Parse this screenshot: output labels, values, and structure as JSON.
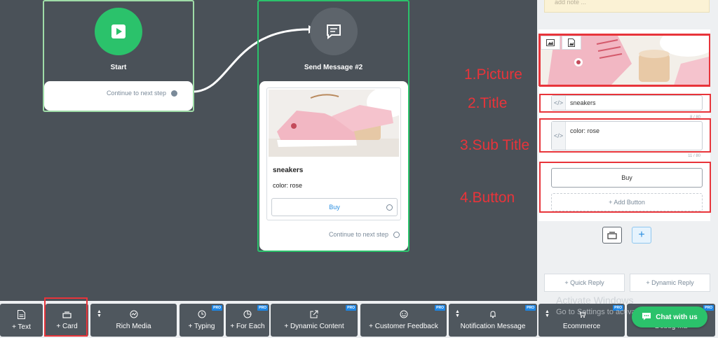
{
  "canvas": {
    "start_node": {
      "title": "Start",
      "continue_text": "Continue to next step"
    },
    "send_node": {
      "title": "Send Message #2",
      "card": {
        "title": "sneakers",
        "subtitle": "color: rose",
        "button_label": "Buy"
      },
      "continue_text": "Continue to next step"
    }
  },
  "annotations": [
    "1.Picture",
    "2.Title",
    "3.Sub Title",
    "4.Button"
  ],
  "panel": {
    "note_placeholder": "add note ...",
    "title_value": "sneakers",
    "title_count": "8 / 80",
    "subtitle_value": "color: rose",
    "subtitle_count": "11 / 80",
    "button_label": "Buy",
    "add_button_label": "+ Add Button",
    "quick_reply_label": "+ Quick Reply",
    "dynamic_reply_label": "+ Dynamic Reply"
  },
  "watermark": {
    "line1": "Activate Windows",
    "line2": "Go to Settings to activate Windows."
  },
  "toolbar": {
    "items": [
      {
        "label": "+ Text",
        "icon": "document-icon",
        "pro": false
      },
      {
        "label": "+ Card",
        "icon": "card-icon",
        "pro": false
      },
      {
        "label": "Rich Media",
        "icon": "media-icon",
        "pro": false
      },
      {
        "label": "+ Typing",
        "icon": "clock-icon",
        "pro": true
      },
      {
        "label": "+ For Each",
        "icon": "pie-icon",
        "pro": true
      },
      {
        "label": "+ Dynamic Content",
        "icon": "external-link-icon",
        "pro": true
      },
      {
        "label": "+ Customer Feedback",
        "icon": "smiley-icon",
        "pro": true
      },
      {
        "label": "Notification Message",
        "icon": "bell-icon",
        "pro": true
      },
      {
        "label": "Ecommerce",
        "icon": "cart-icon",
        "pro": true
      },
      {
        "label": "Debug Ma",
        "icon": "bug-icon",
        "pro": false
      }
    ],
    "pro_badge": "PRO"
  },
  "chat_widget": {
    "label": "Chat with us"
  },
  "colors": {
    "accent_green": "#2bc26b",
    "annotation_red": "#e8343a",
    "link_blue": "#2a8ee0",
    "canvas_bg": "#4a5158"
  }
}
